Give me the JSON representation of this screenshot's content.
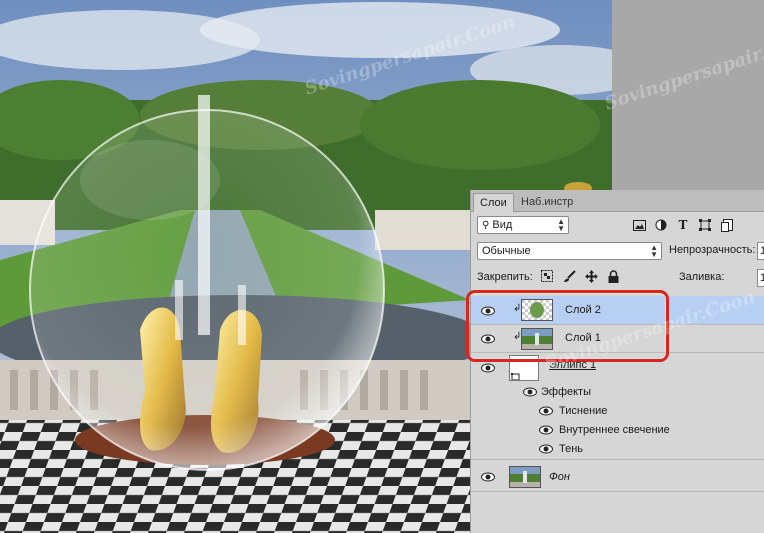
{
  "panel": {
    "tabs": [
      {
        "label": "Слои"
      },
      {
        "label": "Наб.инстр"
      }
    ],
    "filter": {
      "kind_label": "Вид"
    },
    "blend": {
      "mode": "Обычные",
      "opacity_label": "Непрозрачность:",
      "opacity_value": "1"
    },
    "lock": {
      "label": "Закрепить:",
      "fill_label": "Заливка:",
      "fill_value": "1"
    },
    "layers": [
      {
        "name": "Слой 2",
        "selected": true,
        "clipped": true
      },
      {
        "name": "Слой 1",
        "selected": false,
        "clipped": true
      },
      {
        "name": "Эллипс 1",
        "selected": false,
        "clipped": false
      },
      {
        "name": "Фон",
        "selected": false,
        "clipped": false
      }
    ],
    "effects": {
      "label": "Эффекты",
      "items": [
        "Тиснение",
        "Внутреннее свечение",
        "Тень"
      ]
    }
  },
  "watermark": "Sovingpersapair.Coon",
  "colors": {
    "highlight": "#d7261e",
    "selected_row": "#b7cff2",
    "panel_bg": "#d6d6d6"
  },
  "icons": [
    "search-icon",
    "image-filter-icon",
    "adjustment-filter-icon",
    "type-filter-icon",
    "shape-filter-icon",
    "smartobject-filter-icon",
    "lock-pixels-icon",
    "lock-paint-icon",
    "lock-move-icon",
    "lock-all-icon",
    "eye-icon",
    "clip-arrow-icon"
  ]
}
